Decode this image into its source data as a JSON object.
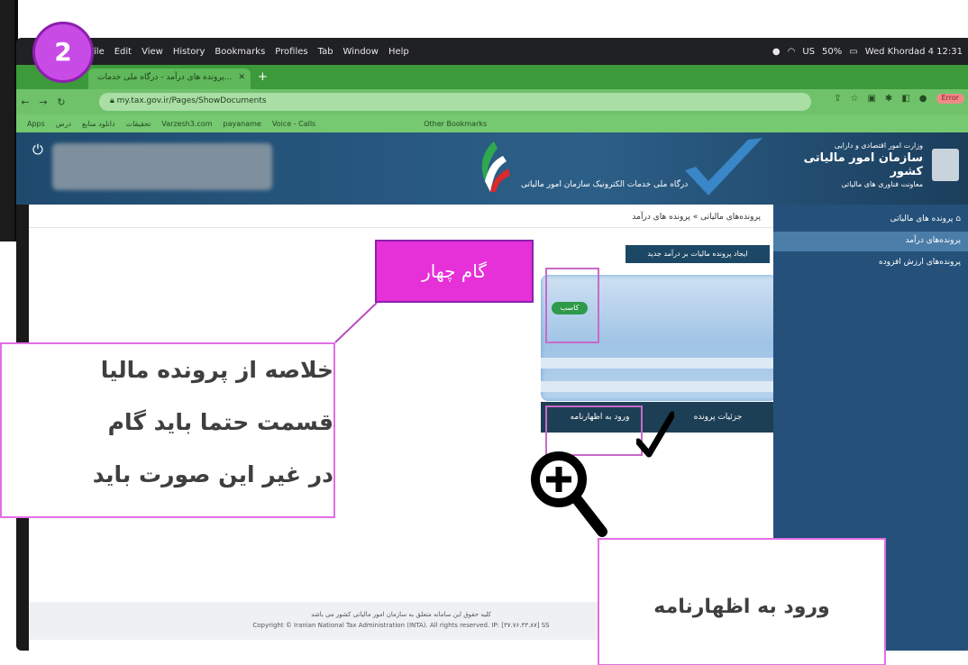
{
  "step_badge": "2",
  "menubar": {
    "items": [
      "File",
      "Edit",
      "View",
      "History",
      "Bookmarks",
      "Profiles",
      "Tab",
      "Window",
      "Help"
    ],
    "status": [
      "US",
      "50%",
      "Wed Khordad 4  12:31"
    ]
  },
  "browser": {
    "tab_title": "پرونده های درآمد - درگاه ملی خدمات...",
    "url": "my.tax.gov.ir/Pages/ShowDocuments",
    "error_label": "Error",
    "bookmarks": [
      "Apps",
      "درس",
      "دانلود منابع",
      "تحقیقات",
      "Varzesh3.com",
      "payaname",
      "Voice - Calls",
      "Other Bookmarks"
    ]
  },
  "site": {
    "org_small": "وزارت امور اقتصادی و دارایی",
    "org_title": "سازمان امور مالیاتی کشور",
    "org_sub": "معاونت فناوری های مالیاتی",
    "portal": "درگاه ملی خدمات الکترونیک سازمان امور مالیاتی"
  },
  "breadcrumb": "پرونده‌های مالیاتی  »  پرونده های درآمد",
  "create_button": "ایجاد پرونده مالیات بر درآمد جدید",
  "card": {
    "badge": "کاسب",
    "details_button": "جزئیات پرونده",
    "enter_button": "ورود به اظهارنامه"
  },
  "sidebar": {
    "items": [
      "پرونده های مالیاتی",
      "پرونده‌های درآمد",
      "پرونده‌های ارزش افزوده"
    ]
  },
  "footer": {
    "line1": "کلیه حقوق این سامانه متعلق به سازمان امور مالیاتی کشور می باشد",
    "line2": "Copyright © Iranian National Tax Administration (INTA). All rights reserved. IP: [۳۷.۷۶.۳۳.۸۷] SS"
  },
  "annotations": {
    "step_callout": "گام چهار",
    "text_lines": [
      "خلاصه از پرونده مالیا",
      "قسمت حتما باید گام",
      "در غیر این صورت باید"
    ],
    "enter_callout": "ورود به اظهارنامه"
  }
}
